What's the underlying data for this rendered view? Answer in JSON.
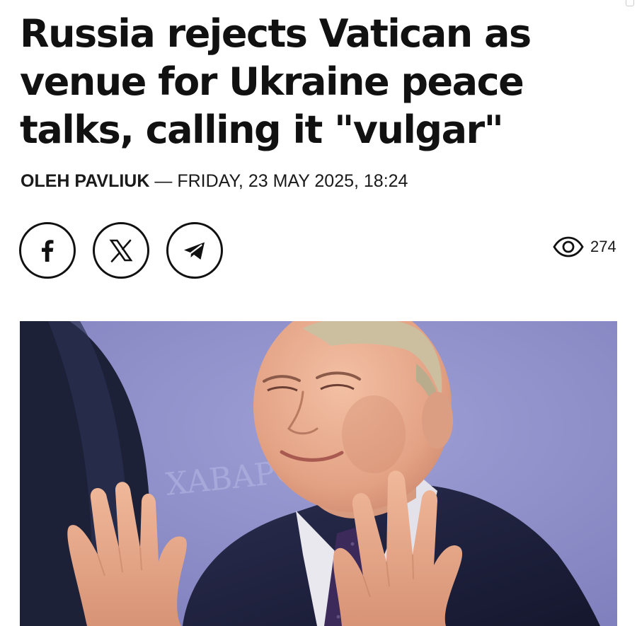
{
  "article": {
    "headline": "Russia rejects Vatican as venue for Ukraine peace talks, calling it \"vulgar\"",
    "author": "OLEH PAVLIUK",
    "separator": " — ",
    "date": "FRIDAY, 23 MAY 2025, 18:24"
  },
  "share": {
    "facebook_icon": "facebook-icon",
    "x_icon": "x-icon",
    "telegram_icon": "telegram-icon"
  },
  "views": {
    "icon": "eye-icon",
    "count": "274"
  },
  "hero_image": {
    "backdrop_text": "XABAPO"
  },
  "colors": {
    "text": "#111111",
    "backdrop": "#8e8dc6"
  }
}
